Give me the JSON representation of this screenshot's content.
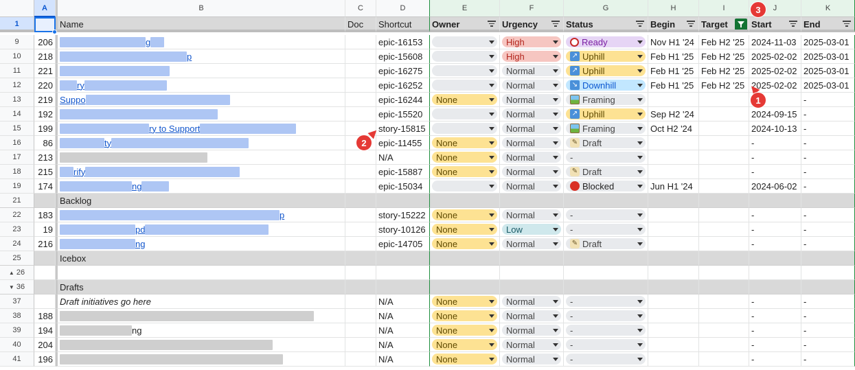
{
  "columns": [
    {
      "key": "A",
      "label": "A"
    },
    {
      "key": "B",
      "label": "B"
    },
    {
      "key": "C",
      "label": "C"
    },
    {
      "key": "D",
      "label": "D"
    },
    {
      "key": "E",
      "label": "E"
    },
    {
      "key": "F",
      "label": "F"
    },
    {
      "key": "G",
      "label": "G"
    },
    {
      "key": "H",
      "label": "H"
    },
    {
      "key": "I",
      "label": "I"
    },
    {
      "key": "J",
      "label": "J"
    },
    {
      "key": "K",
      "label": "K"
    }
  ],
  "header_row": {
    "row_number": "1",
    "name": "Name",
    "doc": "Doc",
    "shortcut": "Shortcut",
    "owner": "Owner",
    "urgency": "Urgency",
    "status": "Status",
    "begin": "Begin",
    "target": "Target",
    "start": "Start",
    "end": "End"
  },
  "rows": [
    {
      "rn": "9",
      "id": "206",
      "shortcut": "epic-16153",
      "owner": "",
      "urgency": "High",
      "status": "Ready",
      "status_icon": "alarm-clock-icon",
      "begin": "Nov H1 '24",
      "target": "Feb H2 '25",
      "start": "2024-11-03",
      "end": "2025-03-01",
      "name_text": "g"
    },
    {
      "rn": "10",
      "id": "218",
      "shortcut": "epic-15608",
      "owner": "",
      "urgency": "High",
      "status": "Uphill",
      "status_icon": "arrow-up-right-icon",
      "begin": "Feb H1 '25",
      "target": "Feb H2 '25",
      "start": "2025-02-02",
      "end": "2025-03-01",
      "name_text": "p"
    },
    {
      "rn": "11",
      "id": "221",
      "shortcut": "epic-16275",
      "owner": "",
      "urgency": "Normal",
      "status": "Uphill",
      "status_icon": "arrow-up-right-icon",
      "begin": "Feb H1 '25",
      "target": "Feb H2 '25",
      "start": "2025-02-02",
      "end": "2025-03-01",
      "name_text": ""
    },
    {
      "rn": "12",
      "id": "220",
      "shortcut": "epic-16252",
      "owner": "",
      "urgency": "Normal",
      "status": "Downhill",
      "status_icon": "arrow-down-right-icon",
      "begin": "Feb H1 '25",
      "target": "Feb H2 '25",
      "start": "2025-02-02",
      "end": "2025-03-01",
      "name_text": "ry"
    },
    {
      "rn": "13",
      "id": "219",
      "shortcut": "epic-16244",
      "owner": "None",
      "urgency": "Normal",
      "status": "Framing",
      "status_icon": "framed-picture-icon",
      "begin": "",
      "target": "",
      "start": "-",
      "end": "-",
      "name_text": "Suppo"
    },
    {
      "rn": "14",
      "id": "192",
      "shortcut": "epic-15520",
      "owner": "",
      "urgency": "Normal",
      "status": "Uphill",
      "status_icon": "arrow-up-right-icon",
      "begin": "Sep H2 '24",
      "target": "",
      "start": "2024-09-15",
      "end": "-",
      "name_text": ""
    },
    {
      "rn": "15",
      "id": "199",
      "shortcut": "story-15815",
      "owner": "",
      "urgency": "Normal",
      "status": "Framing",
      "status_icon": "framed-picture-icon",
      "begin": "Oct H2 '24",
      "target": "",
      "start": "2024-10-13",
      "end": "-",
      "name_text": "ry to Support"
    },
    {
      "rn": "16",
      "id": "86",
      "shortcut": "epic-11455",
      "owner": "None",
      "urgency": "Normal",
      "status": "Draft",
      "status_icon": "draft-icon",
      "begin": "",
      "target": "",
      "start": "-",
      "end": "-",
      "name_text": "ty"
    },
    {
      "rn": "17",
      "id": "213",
      "shortcut": "N/A",
      "owner": "None",
      "urgency": "Normal",
      "status": "-",
      "status_icon": "",
      "begin": "",
      "target": "",
      "start": "-",
      "end": "-",
      "name_text": ""
    },
    {
      "rn": "18",
      "id": "215",
      "shortcut": "epic-15887",
      "owner": "None",
      "urgency": "Normal",
      "status": "Draft",
      "status_icon": "draft-icon",
      "begin": "",
      "target": "",
      "start": "-",
      "end": "-",
      "name_text": "rify"
    },
    {
      "rn": "19",
      "id": "174",
      "shortcut": "epic-15034",
      "owner": "",
      "urgency": "Normal",
      "status": "Blocked",
      "status_icon": "red-circle-icon",
      "begin": "Jun H1 '24",
      "target": "",
      "start": "2024-06-02",
      "end": "-",
      "name_text": "ng"
    },
    {
      "rn": "21",
      "section": "Backlog"
    },
    {
      "rn": "22",
      "id": "183",
      "shortcut": "story-15222",
      "owner": "None",
      "urgency": "Normal",
      "status": "-",
      "status_icon": "",
      "begin": "",
      "target": "",
      "start": "-",
      "end": "-",
      "name_text": "p"
    },
    {
      "rn": "23",
      "id": "19",
      "shortcut": "story-10126",
      "owner": "None",
      "urgency": "Low",
      "status": "-",
      "status_icon": "",
      "begin": "",
      "target": "",
      "start": "-",
      "end": "-",
      "name_text": "pd"
    },
    {
      "rn": "24",
      "id": "216",
      "shortcut": "epic-14705",
      "owner": "None",
      "urgency": "Normal",
      "status": "Draft",
      "status_icon": "draft-icon",
      "begin": "",
      "target": "",
      "start": "-",
      "end": "-",
      "name_text": "ng"
    },
    {
      "rn": "25",
      "section": "Icebox"
    },
    {
      "rn": "26",
      "blank": true,
      "collapse": "up"
    },
    {
      "rn": "36",
      "section": "Drafts",
      "collapse": "down"
    },
    {
      "rn": "37",
      "id": "",
      "shortcut": "N/A",
      "owner": "None",
      "urgency": "Normal",
      "status": "-",
      "status_icon": "",
      "begin": "",
      "target": "",
      "start": "-",
      "end": "-",
      "name_text": "Draft initiatives go here",
      "italic": true
    },
    {
      "rn": "38",
      "id": "188",
      "shortcut": "N/A",
      "owner": "None",
      "urgency": "Normal",
      "status": "-",
      "status_icon": "",
      "begin": "",
      "target": "",
      "start": "-",
      "end": "-",
      "name_text": ""
    },
    {
      "rn": "39",
      "id": "194",
      "shortcut": "N/A",
      "owner": "None",
      "urgency": "Normal",
      "status": "-",
      "status_icon": "",
      "begin": "",
      "target": "",
      "start": "-",
      "end": "-",
      "name_text": "ng"
    },
    {
      "rn": "40",
      "id": "204",
      "shortcut": "N/A",
      "owner": "None",
      "urgency": "Normal",
      "status": "-",
      "status_icon": "",
      "begin": "",
      "target": "",
      "start": "-",
      "end": "-",
      "name_text": ""
    },
    {
      "rn": "41",
      "id": "196",
      "shortcut": "N/A",
      "owner": "None",
      "urgency": "Normal",
      "status": "-",
      "status_icon": "",
      "begin": "",
      "target": "",
      "start": "-",
      "end": "-",
      "name_text": ""
    }
  ],
  "badges": [
    "1",
    "2",
    "3"
  ],
  "colors": {
    "filter_active": "#137333",
    "selection": "#1a73e8",
    "badge": "#e53935",
    "link": "#1155cc"
  }
}
